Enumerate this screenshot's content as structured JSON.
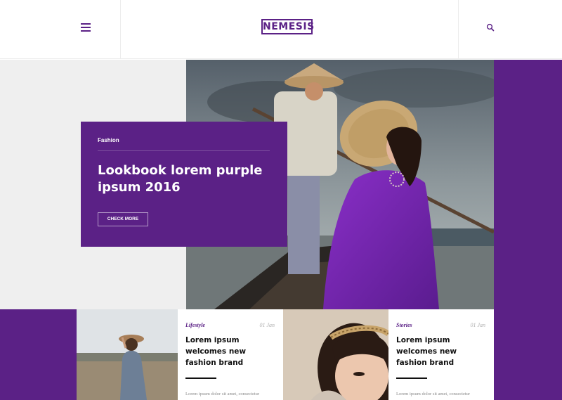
{
  "header": {
    "logo": "NEMESIS",
    "menu_icon": "hamburger-icon",
    "search_icon": "search-icon"
  },
  "hero": {
    "category": "Fashion",
    "title": "Lookbook lorem purple ipsum 2016",
    "button_label": "CHECK MORE",
    "image": "woman-in-purple-ao-dai-on-boat"
  },
  "cards": [
    {
      "category": "Lifestyle",
      "date": "01 Jan",
      "title": "Lorem ipsum welcomes new fashion brand",
      "excerpt": "Lorem ipsum dolor sit amet, consectetur",
      "image": "woman-with-hat-in-field"
    },
    {
      "category": "Stories",
      "date": "01 Jan",
      "title": "Lorem ipsum welcomes new fashion brand",
      "excerpt": "Lorem ipsum dolor sit amet, consectetur",
      "image": "woman-with-headband"
    }
  ],
  "colors": {
    "brand_purple": "#5b2186",
    "hero_bg_gray": "#efefef",
    "divider": "#ececec"
  }
}
